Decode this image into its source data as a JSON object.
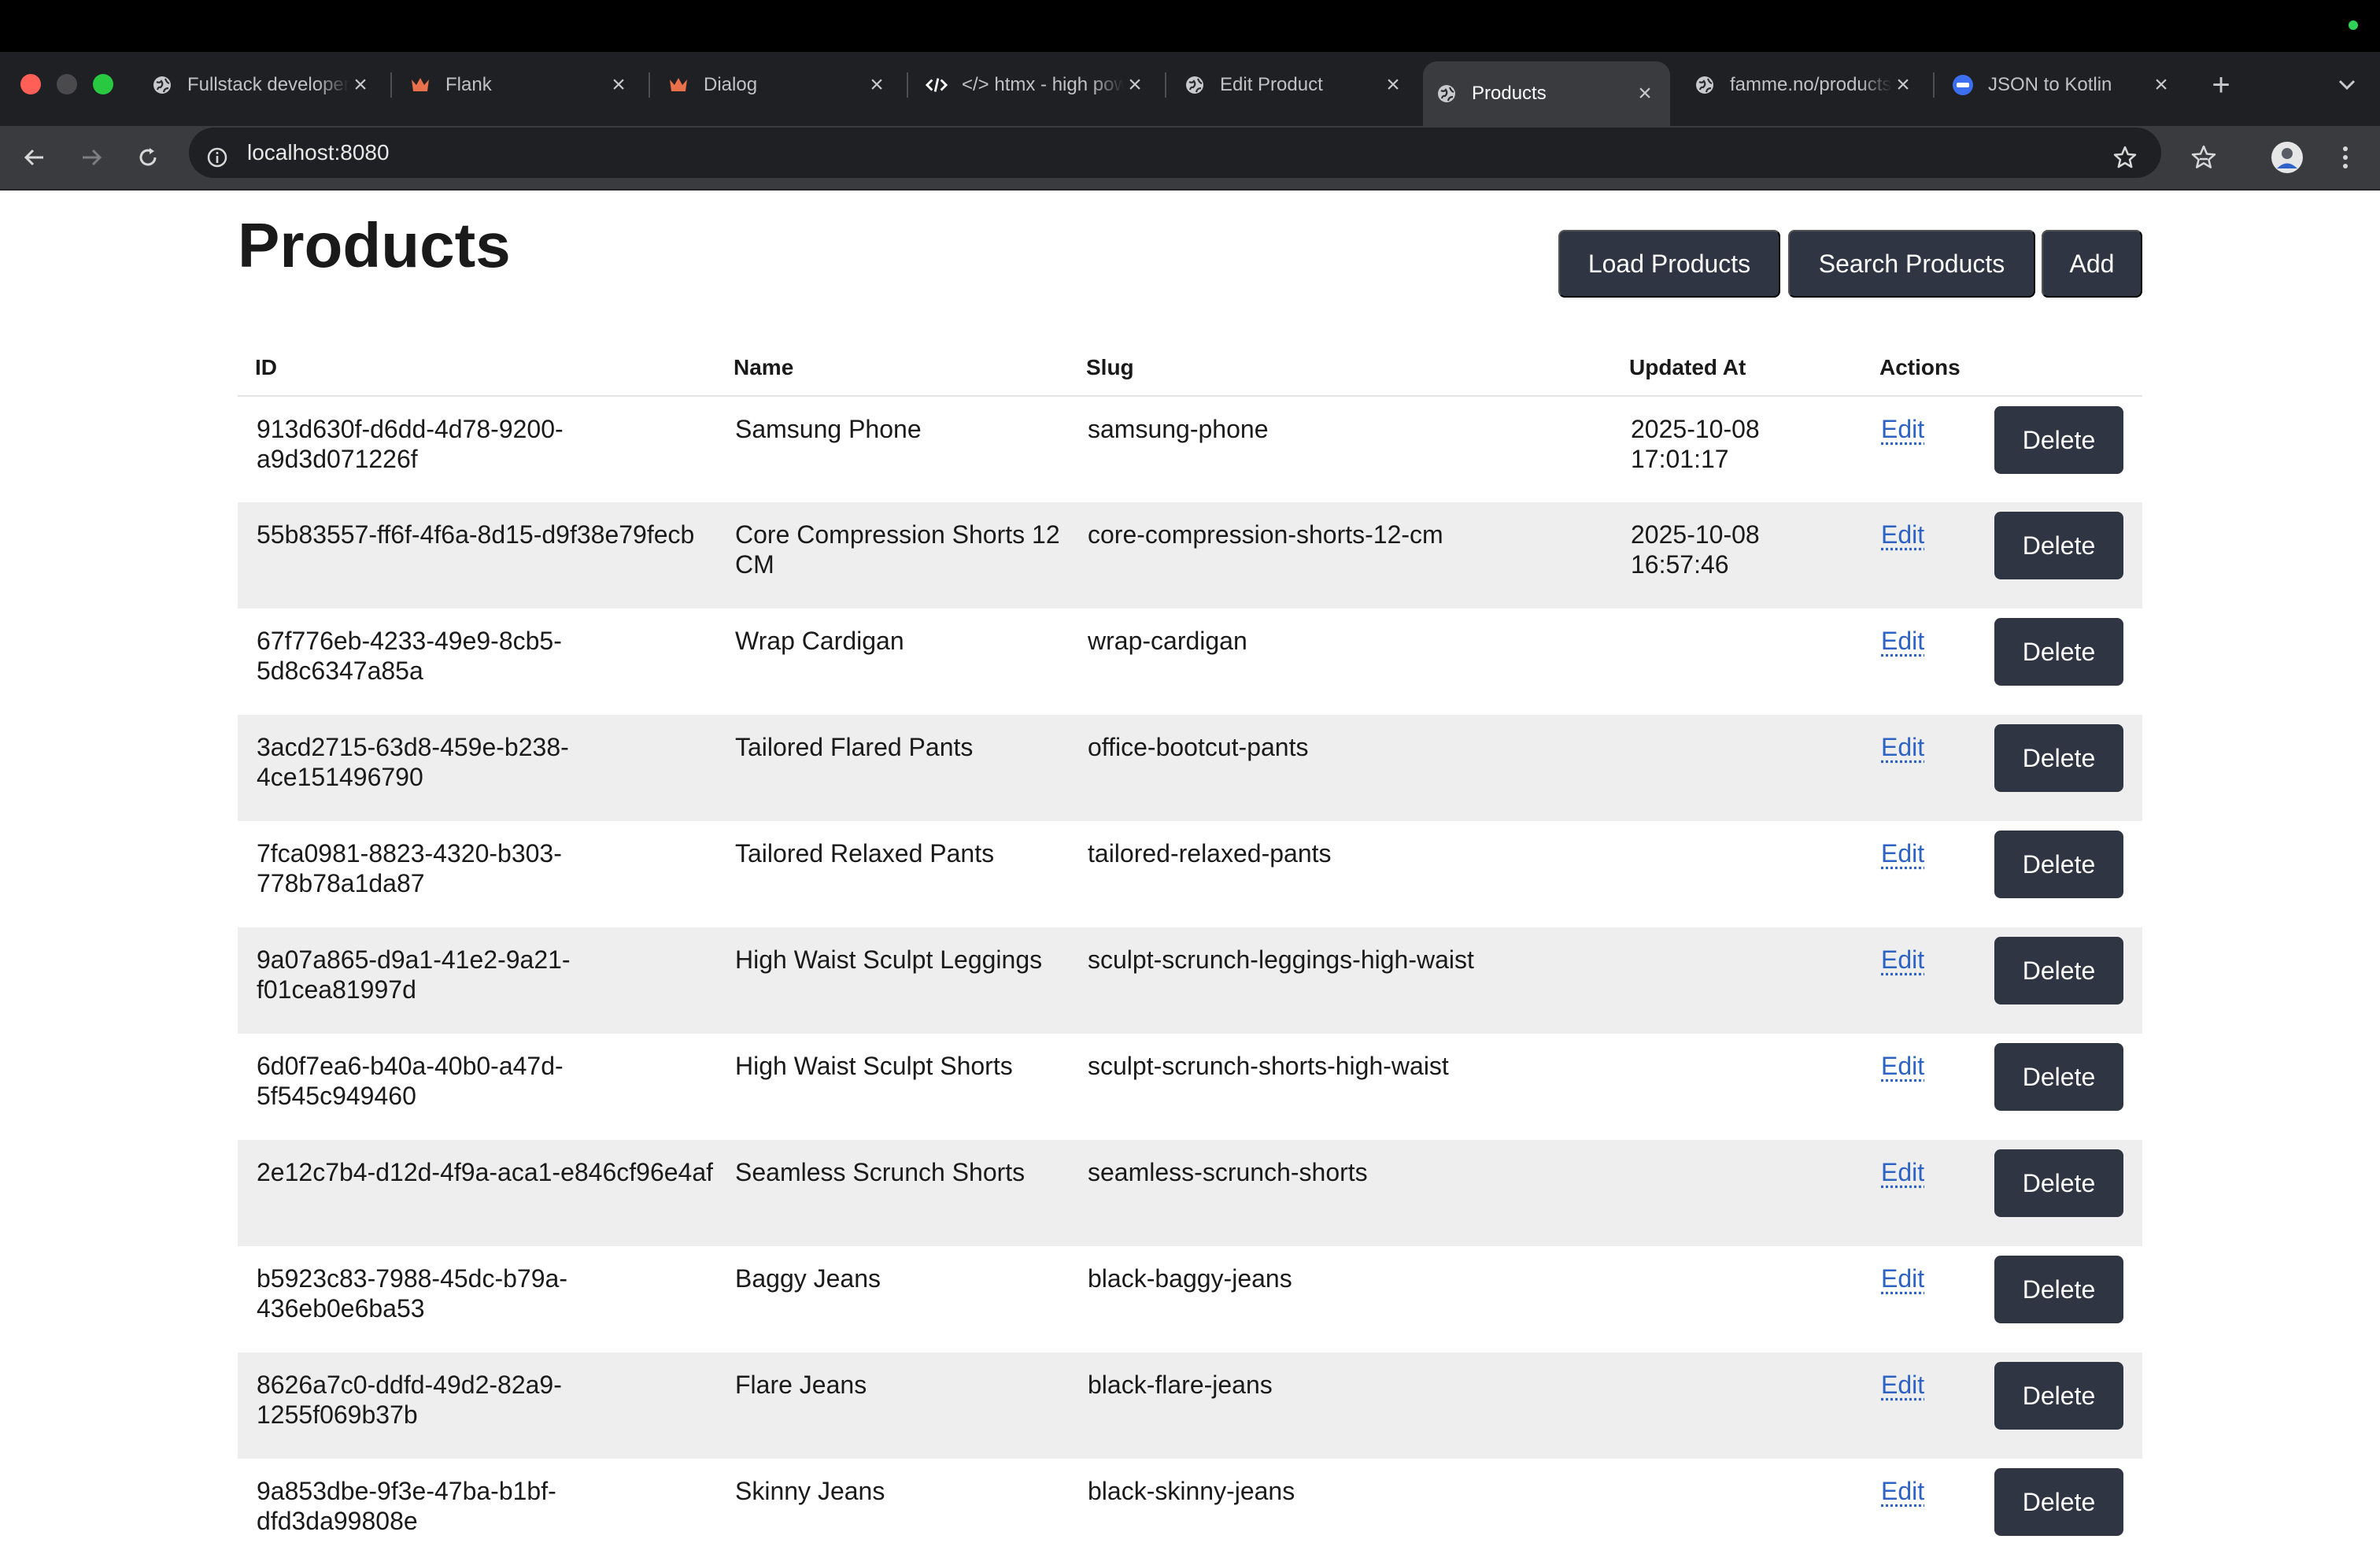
{
  "browser": {
    "tabs": [
      {
        "title": "Fullstack developer",
        "icon": "globe-icon",
        "active": false
      },
      {
        "title": "Flank",
        "icon": "crown-icon",
        "active": false
      },
      {
        "title": "Dialog",
        "icon": "crown-icon",
        "active": false
      },
      {
        "title": "</> htmx - high power tools",
        "icon": "code-icon",
        "active": false
      },
      {
        "title": "Edit Product",
        "icon": "globe-icon",
        "active": false
      },
      {
        "title": "Products",
        "icon": "globe-icon",
        "active": true
      },
      {
        "title": "famme.no/products",
        "icon": "globe-icon",
        "active": false
      },
      {
        "title": "JSON to Kotlin",
        "icon": "kotlin-icon",
        "active": false
      }
    ],
    "close_glyph": "×",
    "new_tab_glyph": "+",
    "url": "localhost:8080",
    "colors": {
      "chrome_dark": "#1f2023",
      "chrome_active": "#3a3b3e",
      "close_red": "#ff5f57",
      "maximize_green": "#28c840"
    }
  },
  "page": {
    "title": "Products",
    "buttons": {
      "load": "Load Products",
      "search": "Search Products",
      "add": "Add"
    },
    "table": {
      "headers": {
        "id": "ID",
        "name": "Name",
        "slug": "Slug",
        "updated_at": "Updated At",
        "actions": "Actions"
      },
      "edit_label": "Edit",
      "delete_label": "Delete",
      "rows": [
        {
          "id": "913d630f-d6dd-4d78-9200-a9d3d071226f",
          "name": "Samsung Phone",
          "slug": "samsung-phone",
          "updated_at": "2025-10-08 17:01:17"
        },
        {
          "id": "55b83557-ff6f-4f6a-8d15-d9f38e79fecb",
          "name": "Core Compression Shorts 12 CM",
          "slug": "core-compression-shorts-12-cm",
          "updated_at": "2025-10-08 16:57:46"
        },
        {
          "id": "67f776eb-4233-49e9-8cb5-5d8c6347a85a",
          "name": "Wrap Cardigan",
          "slug": "wrap-cardigan",
          "updated_at": ""
        },
        {
          "id": "3acd2715-63d8-459e-b238-4ce151496790",
          "name": "Tailored Flared Pants",
          "slug": "office-bootcut-pants",
          "updated_at": ""
        },
        {
          "id": "7fca0981-8823-4320-b303-778b78a1da87",
          "name": "Tailored Relaxed Pants",
          "slug": "tailored-relaxed-pants",
          "updated_at": ""
        },
        {
          "id": "9a07a865-d9a1-41e2-9a21-f01cea81997d",
          "name": "High Waist Sculpt Leggings",
          "slug": "sculpt-scrunch-leggings-high-waist",
          "updated_at": ""
        },
        {
          "id": "6d0f7ea6-b40a-40b0-a47d-5f545c949460",
          "name": "High Waist Sculpt Shorts",
          "slug": "sculpt-scrunch-shorts-high-waist",
          "updated_at": ""
        },
        {
          "id": "2e12c7b4-d12d-4f9a-aca1-e846cf96e4af",
          "name": "Seamless Scrunch Shorts",
          "slug": "seamless-scrunch-shorts",
          "updated_at": ""
        },
        {
          "id": "b5923c83-7988-45dc-b79a-436eb0e6ba53",
          "name": "Baggy Jeans",
          "slug": "black-baggy-jeans",
          "updated_at": ""
        },
        {
          "id": "8626a7c0-ddfd-49d2-82a9-1255f069b37b",
          "name": "Flare Jeans",
          "slug": "black-flare-jeans",
          "updated_at": ""
        },
        {
          "id": "9a853dbe-9f3e-47ba-b1bf-dfd3da99808e",
          "name": "Skinny Jeans",
          "slug": "black-skinny-jeans",
          "updated_at": ""
        }
      ]
    },
    "colors": {
      "button_bg": "#2f3542",
      "link": "#2e63c6",
      "row_alt": "#eeeeee"
    }
  }
}
